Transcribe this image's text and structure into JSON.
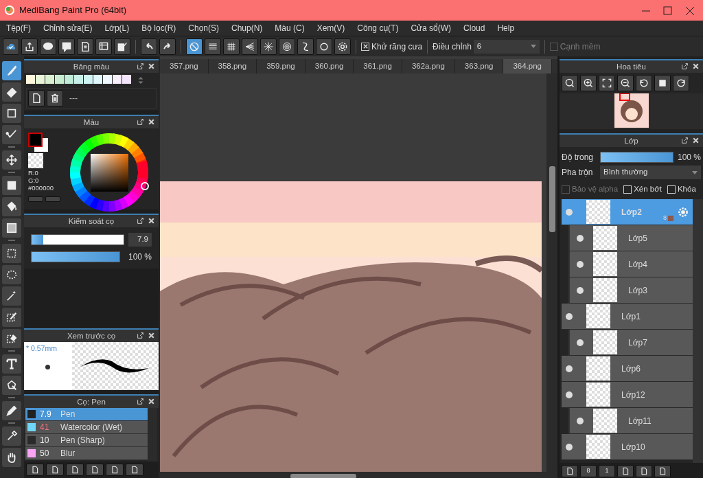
{
  "window": {
    "title": "MediBang Paint Pro (64bit)"
  },
  "menu": [
    "Tệp(F)",
    "Chỉnh sửa(E)",
    "Lớp(L)",
    "Bộ lọc(R)",
    "Chọn(S)",
    "Chụp(N)",
    "Màu (C)",
    "Xem(V)",
    "Công cụ(T)",
    "Cửa sổ(W)",
    "Cloud",
    "Help"
  ],
  "toolbar": {
    "snaps": [
      {
        "selected": true
      },
      {
        "selected": false
      },
      {
        "selected": false
      },
      {
        "selected": false
      },
      {
        "selected": false
      },
      {
        "selected": false
      },
      {
        "selected": false
      },
      {
        "selected": false
      },
      {
        "selected": false
      }
    ],
    "antialias": {
      "label": "Khử răng cưa",
      "checked": true
    },
    "correction": {
      "label": "Điều chỉnh",
      "value": "6"
    },
    "soft_edge": {
      "label": "Cạnh mềm",
      "checked": false,
      "disabled": true
    }
  },
  "tools": [
    {
      "selected": true
    },
    {
      "selected": false
    },
    {
      "selected": false
    },
    {
      "selected": false
    },
    {
      "selected": false
    },
    {
      "selected": false
    },
    {
      "selected": false
    },
    {
      "selected": false
    },
    {
      "selected": false
    },
    {
      "selected": false
    },
    {
      "selected": false
    },
    {
      "selected": false
    },
    {
      "selected": false
    },
    {
      "selected": false
    },
    {
      "selected": false
    },
    {
      "selected": false
    },
    {
      "selected": false
    },
    {
      "selected": false
    }
  ],
  "palette_panel": {
    "title": "Bảng màu",
    "swatches": [
      {
        "color": "#fff8dc"
      },
      {
        "color": "#e8f5d8"
      },
      {
        "color": "#d8f0d0"
      },
      {
        "color": "#c8ecd0"
      },
      {
        "color": "#c0ecd8"
      },
      {
        "color": "#c8f0e8"
      },
      {
        "color": "#d0f4f4"
      },
      {
        "color": "#e0f8fc"
      },
      {
        "color": "#f0f8ff"
      },
      {
        "color": "#f8f0fc"
      },
      {
        "color": "#f4e4fc"
      }
    ],
    "palette_name": "---"
  },
  "color_panel": {
    "title": "Màu",
    "r": "R:0",
    "g": "G:0",
    "hex": "#000000"
  },
  "brush_control": {
    "title": "Kiểm soát cọ",
    "size": {
      "level": 0.13,
      "value": "7.9"
    },
    "opacity": {
      "level": 1.0,
      "value": "100 %"
    }
  },
  "brush_preview": {
    "title": "Xem trước cọ",
    "size_text": "* 0.57mm"
  },
  "brush_list": {
    "title": "Cọ: Pen",
    "items": [
      {
        "size": "7.9",
        "name": "Pen",
        "color": "#222222",
        "selected": true
      },
      {
        "size": "41",
        "name": "Watercolor (Wet)",
        "color": "#6fd8f8",
        "selected": false
      },
      {
        "size": "10",
        "name": "Pen (Sharp)",
        "color": "#2a2a2a",
        "selected": false
      },
      {
        "size": "50",
        "name": "Blur",
        "color": "#fca4f4",
        "selected": false
      }
    ]
  },
  "tabs": [
    {
      "label": "357.png",
      "selected": false
    },
    {
      "label": "358.png",
      "selected": false
    },
    {
      "label": "359.png",
      "selected": false
    },
    {
      "label": "360.png",
      "selected": false
    },
    {
      "label": "361.png",
      "selected": false
    },
    {
      "label": "362a.png",
      "selected": false
    },
    {
      "label": "363.png",
      "selected": false
    },
    {
      "label": "364.png",
      "selected": true
    }
  ],
  "navigator": {
    "title": "Hoa tiêu"
  },
  "layer_panel": {
    "title": "Lớp",
    "opacity": {
      "label": "Độ trong",
      "level": 1.0,
      "value": "100 %"
    },
    "blend": {
      "label": "Pha trộn",
      "value": "Bình thường"
    },
    "options": [
      {
        "label": "Bảo vệ alpha",
        "checked": false,
        "disabled": true
      },
      {
        "label": "Xén bớt",
        "checked": false,
        "disabled": false
      },
      {
        "label": "Khóa",
        "checked": false,
        "disabled": false
      }
    ],
    "layers": [
      {
        "name": "Lớp2",
        "visible": true,
        "clipped": false,
        "selected": true,
        "badge": "8"
      },
      {
        "name": "Lớp5",
        "visible": true,
        "clipped": true,
        "selected": false
      },
      {
        "name": "Lớp4",
        "visible": true,
        "clipped": true,
        "selected": false
      },
      {
        "name": "Lớp3",
        "visible": true,
        "clipped": true,
        "selected": false
      },
      {
        "name": "Lớp1",
        "visible": true,
        "clipped": false,
        "selected": false
      },
      {
        "name": "Lớp7",
        "visible": true,
        "clipped": true,
        "selected": false
      },
      {
        "name": "Lớp6",
        "visible": true,
        "clipped": false,
        "selected": false
      },
      {
        "name": "Lớp12",
        "visible": true,
        "clipped": false,
        "selected": false
      },
      {
        "name": "Lớp11",
        "visible": true,
        "clipped": true,
        "selected": false
      },
      {
        "name": "Lớp10",
        "visible": true,
        "clipped": false,
        "selected": false
      }
    ],
    "button_digits": [
      "8",
      "1"
    ]
  }
}
